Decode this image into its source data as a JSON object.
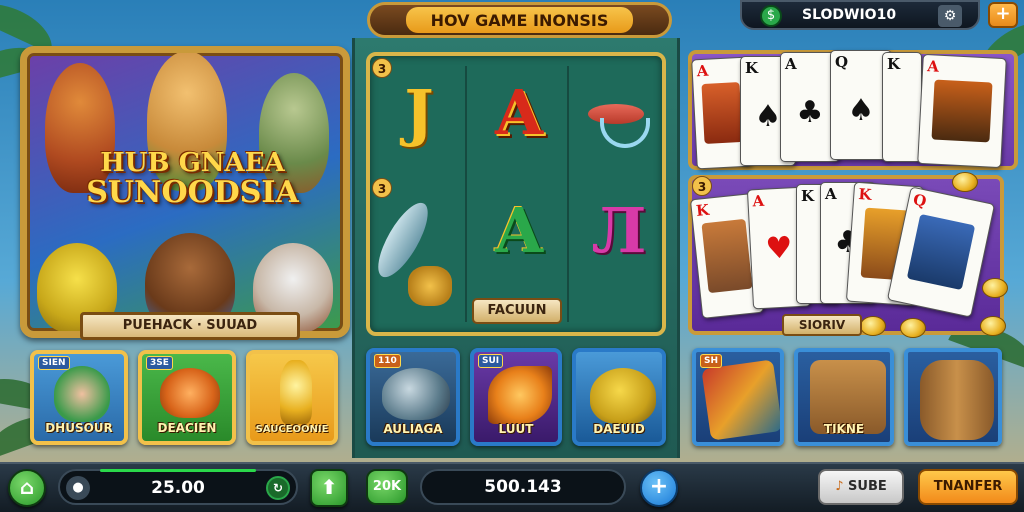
{
  "left_panel": {
    "title_line1": "HUB GNAEA",
    "title_line2": "SUNOODSIA",
    "banner": "PUEHACK · SUUAD",
    "tiles": [
      {
        "badge": "SIEN",
        "label": "DHUSOUR"
      },
      {
        "badge": "3SE",
        "label": "DEACIEN"
      },
      {
        "badge": "",
        "label": "SAUCEOONIE"
      }
    ]
  },
  "middle_panel": {
    "header": "HOV GAME INONSIS",
    "row_badges": [
      "3",
      "3"
    ],
    "symbols": [
      "J",
      "A",
      "A",
      "Л"
    ],
    "button": "FACUUN",
    "tiles": [
      {
        "badge": "110",
        "label": "AULIAGA"
      },
      {
        "badge": "SUI",
        "label": "LUUT"
      },
      {
        "badge": "",
        "label": "DAEUID"
      }
    ]
  },
  "right_panel": {
    "top_bar_text": "SLODWIO10",
    "row_badge": "3",
    "banner": "SIORIV",
    "cards_row1": [
      {
        "rank": "A",
        "suit": "♦",
        "color": "red"
      },
      {
        "rank": "K",
        "suit": "♠",
        "color": "blk"
      },
      {
        "rank": "A",
        "suit": "♣",
        "color": "blk"
      },
      {
        "rank": "Q",
        "suit": "♠",
        "color": "blk"
      },
      {
        "rank": "K",
        "suit": "♠",
        "color": "blk"
      },
      {
        "rank": "A",
        "suit": "♦",
        "color": "red"
      }
    ],
    "cards_row2": [
      {
        "rank": "K",
        "suit": "♦",
        "color": "red"
      },
      {
        "rank": "A",
        "suit": "♥",
        "color": "red"
      },
      {
        "rank": "K",
        "suit": "♣",
        "color": "blk"
      },
      {
        "rank": "A",
        "suit": "♣",
        "color": "blk"
      },
      {
        "rank": "K",
        "suit": "♥",
        "color": "red"
      },
      {
        "rank": "Q",
        "suit": "♥",
        "color": "red"
      }
    ],
    "tiles": [
      {
        "badge": "SH",
        "label": ""
      },
      {
        "badge": "",
        "label": "TIKNE"
      },
      {
        "badge": "",
        "label": ""
      }
    ]
  },
  "bottom_bar": {
    "balance": "25.00",
    "multiplier_label": "20K",
    "total": "500.143",
    "sound_button": "SUBE",
    "transfer_button": "TNANFER"
  },
  "colors": {
    "gold": "#f2c14a",
    "green_button": "#3fa83a",
    "blue_button": "#2a8ad8",
    "orange_button": "#f2a21a"
  },
  "icons": [
    "home-icon",
    "user-icon",
    "swap-icon",
    "plus-icon",
    "settings-icon",
    "coin-icon"
  ]
}
